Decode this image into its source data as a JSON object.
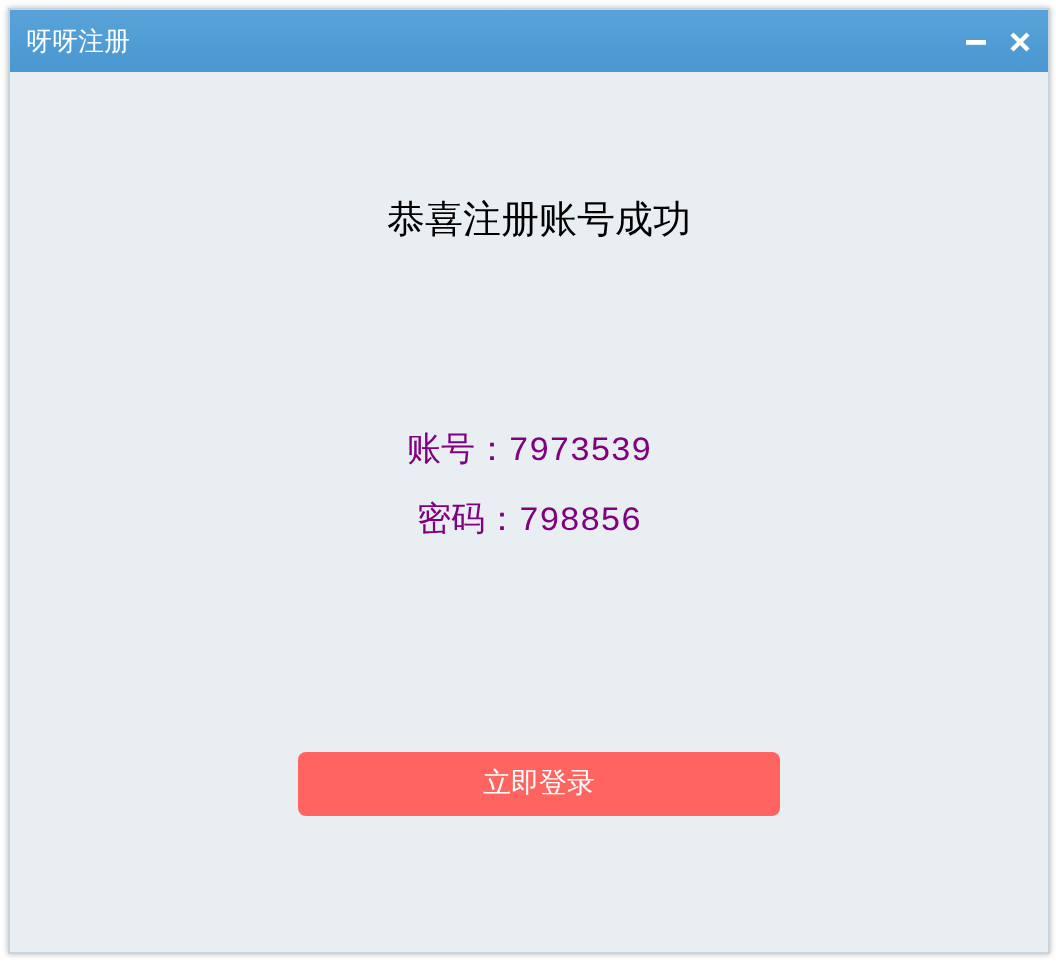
{
  "window": {
    "title": "呀呀注册",
    "controls": [
      {
        "kind": "minimize"
      },
      {
        "kind": "close"
      }
    ]
  },
  "heading": "恭喜注册账号成功",
  "credentials": [
    {
      "text": "账号：7973539"
    },
    {
      "text": "密码：798856"
    }
  ],
  "button": "立即登录"
}
